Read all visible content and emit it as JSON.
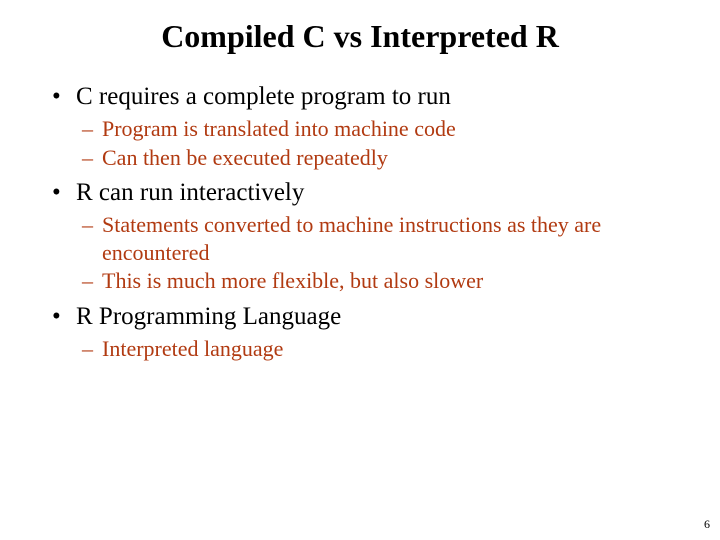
{
  "title": "Compiled C vs Interpreted R",
  "bullets": [
    {
      "text": "C requires a complete program to run",
      "subs": [
        "Program is translated into machine code",
        "Can then be executed repeatedly"
      ]
    },
    {
      "text": "R can run interactively",
      "subs": [
        "Statements converted to machine instructions as they are encountered",
        "This is much more flexible, but also slower"
      ]
    },
    {
      "text": "R Programming Language",
      "subs": [
        "Interpreted language"
      ]
    }
  ],
  "page_number": "6"
}
